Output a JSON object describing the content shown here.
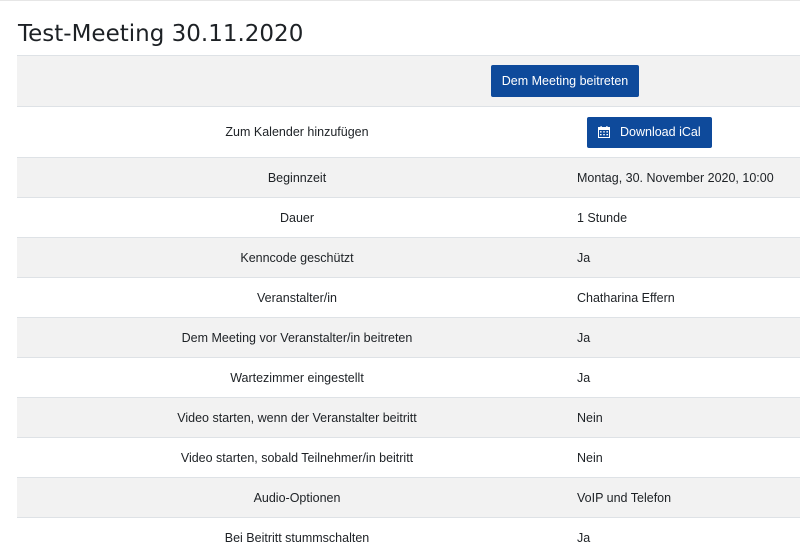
{
  "page": {
    "title": "Test-Meeting 30.11.2020"
  },
  "actions": {
    "join_label": "Dem Meeting beitreten",
    "calendar_label": "Zum Kalender hinzufügen",
    "ical_label": "Download iCal"
  },
  "details": [
    {
      "label": "Beginnzeit",
      "value": "Montag, 30. November 2020, 10:00"
    },
    {
      "label": "Dauer",
      "value": "1 Stunde"
    },
    {
      "label": "Kenncode geschützt",
      "value": "Ja"
    },
    {
      "label": "Veranstalter/in",
      "value": "Chatharina Effern"
    },
    {
      "label": "Dem Meeting vor Veranstalter/in beitreten",
      "value": "Ja"
    },
    {
      "label": "Wartezimmer eingestellt",
      "value": "Ja"
    },
    {
      "label": "Video starten, wenn der Veranstalter beitritt",
      "value": "Nein"
    },
    {
      "label": "Video starten, sobald Teilnehmer/in beitritt",
      "value": "Nein"
    },
    {
      "label": "Audio-Optionen",
      "value": "VoIP und Telefon"
    },
    {
      "label": "Bei Beitritt stummschalten",
      "value": "Ja"
    }
  ],
  "colors": {
    "button_bg": "#0e4a9b",
    "row_stripe": "#f2f2f2"
  },
  "icons": {
    "ical_button_icon": "calendar-icon"
  }
}
